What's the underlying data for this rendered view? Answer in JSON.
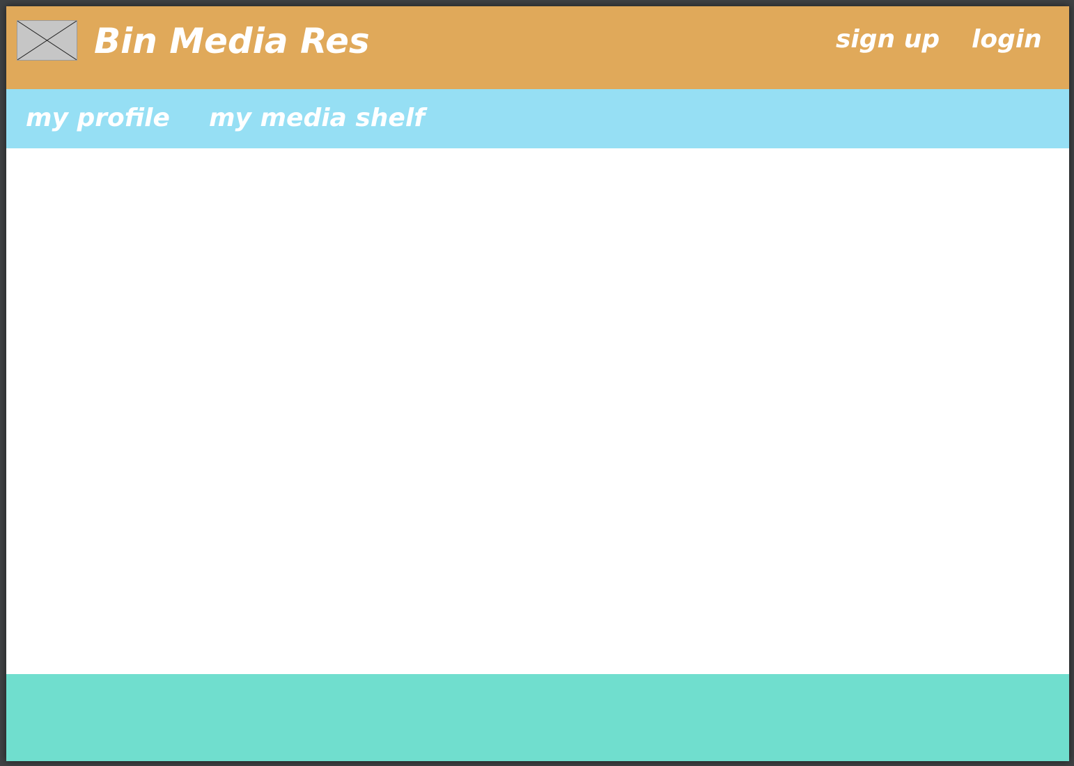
{
  "header": {
    "site_title": "Bin Media Res",
    "signup_label": "sign up",
    "login_label": "login",
    "logo_icon": "image-placeholder-icon"
  },
  "nav": {
    "items": [
      {
        "label": "my profile"
      },
      {
        "label": "my media shelf"
      }
    ]
  },
  "colors": {
    "header_bg": "#e0a95a",
    "nav_bg": "#96dff4",
    "footer_bg": "#70dece",
    "text": "#ffffff"
  }
}
